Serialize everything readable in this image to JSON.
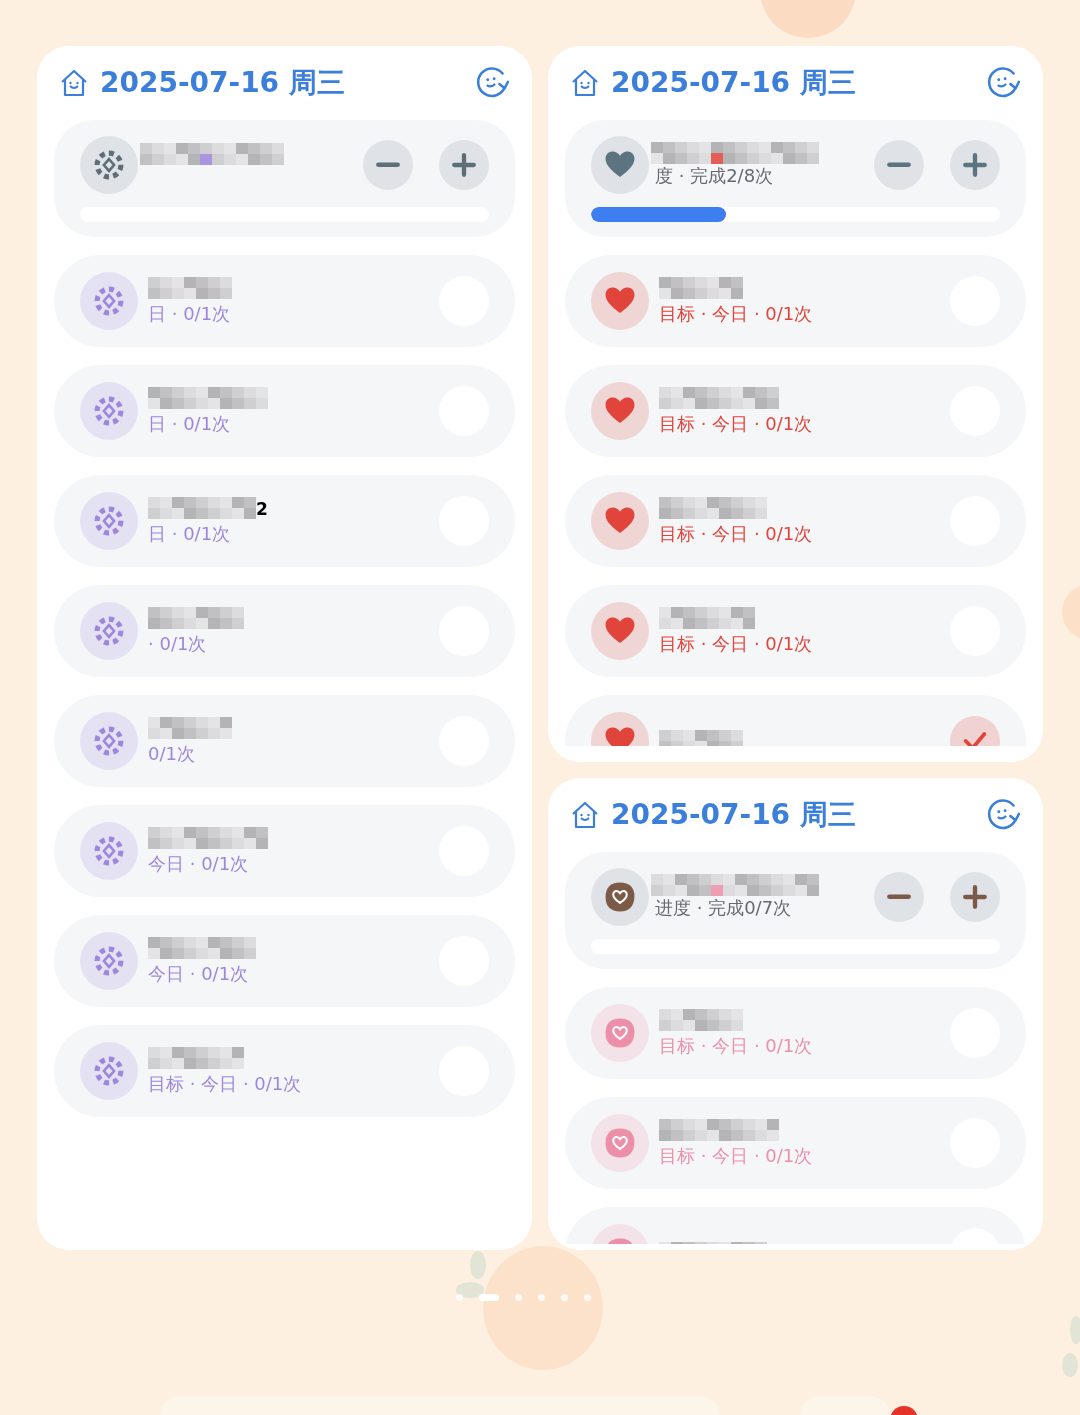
{
  "widgets": [
    {
      "title": "2025-07-16 周三",
      "color": "#9d86dc",
      "main": {
        "kind": "gear",
        "color": "#5d6e76"
      },
      "items": [
        {
          "kind": "gear",
          "subtitle": "日 · 0/1次",
          "checked": false
        },
        {
          "kind": "gear",
          "subtitle": "日 · 0/1次",
          "checked": false
        },
        {
          "kind": "gear",
          "title": "2",
          "subtitle": "日 · 0/1次",
          "checked": false
        },
        {
          "kind": "gear",
          "subtitle": "· 0/1次",
          "checked": false
        },
        {
          "kind": "gear",
          "subtitle": "0/1次",
          "checked": false
        },
        {
          "kind": "gear",
          "subtitle": "今日 · 0/1次",
          "checked": false
        },
        {
          "kind": "gear",
          "subtitle": "今日 · 0/1次",
          "checked": false
        },
        {
          "kind": "gear",
          "subtitle": "目标 · 今日 · 0/1次",
          "checked": false
        }
      ]
    },
    {
      "title": "2025-07-16 周三",
      "color": "#e0443a",
      "main": {
        "kind": "heart",
        "color": "#5c7480",
        "subtitle": "度 · 完成2/8次",
        "level": 0.33
      },
      "items": [
        {
          "kind": "heart",
          "subtitle": "目标 · 今日 · 0/1次",
          "checked": false
        },
        {
          "kind": "heart",
          "subtitle": "目标 · 今日 · 0/1次",
          "checked": false
        },
        {
          "kind": "heart",
          "subtitle": "目标 · 今日 · 0/1次",
          "checked": false
        },
        {
          "kind": "heart",
          "subtitle": "目标 · 今日 · 0/1次",
          "checked": false
        },
        {
          "kind": "heart",
          "checked": true
        }
      ]
    },
    {
      "title": "2025-07-16 周三",
      "color": "#ec8fa8",
      "main": {
        "kind": "bubble",
        "color": "#7b5a47",
        "subtitle": "进度 · 完成0/7次"
      },
      "items": [
        {
          "kind": "bubble",
          "subtitle": "目标 · 今日 · 0/1次",
          "checked": false
        },
        {
          "kind": "bubble",
          "subtitle": "目标 · 今日 · 0/1次",
          "checked": false
        },
        {
          "kind": "bubble",
          "checked": false
        }
      ]
    }
  ],
  "pages": [
    {
      "selected": false
    },
    {
      "selected": true
    },
    {
      "selected": false
    },
    {
      "selected": false
    },
    {
      "selected": false
    },
    {
      "selected": false
    }
  ]
}
